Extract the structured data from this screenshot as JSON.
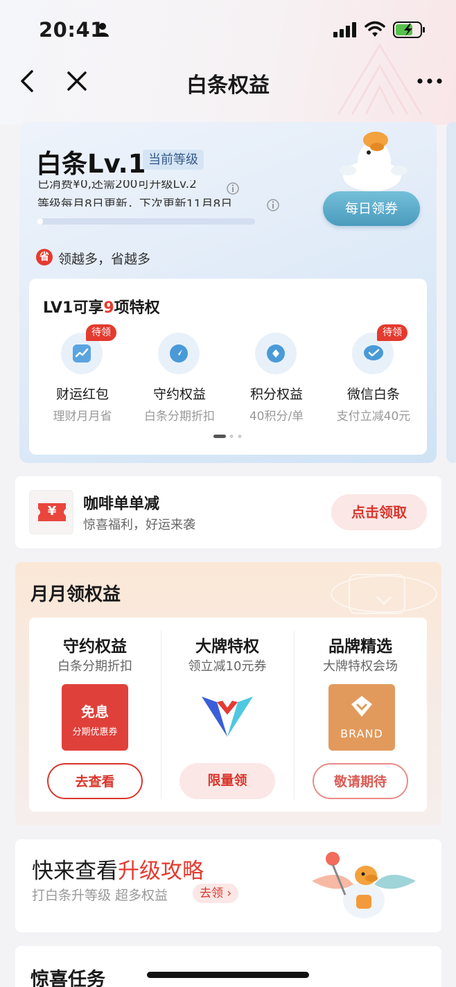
{
  "status_bar": {
    "time": "20:41"
  },
  "nav": {
    "title": "白条权益"
  },
  "level_card": {
    "title": "白条Lv.1",
    "badge": "当前等级",
    "line1": "已消费¥0,还需200可升级Lv.2",
    "line2": "等级每月8日更新，下次更新11月8日",
    "progress": 0.02,
    "daily_button": "每日领券",
    "slogan_icon": "省",
    "slogan": "领越多，省越多",
    "privileges": {
      "title_prefix": "LV1可享",
      "title_count": "9",
      "title_suffix": "项特权",
      "items": [
        {
          "name": "财运红包",
          "sub": "理财月月省",
          "tag": "待领",
          "icon": "chart-icon"
        },
        {
          "name": "守约权益",
          "sub": "白条分期折扣",
          "tag": "",
          "icon": "compass-icon"
        },
        {
          "name": "积分权益",
          "sub": "40积分/单",
          "tag": "",
          "icon": "diamond-icon"
        },
        {
          "name": "微信白条",
          "sub": "支付立减40元",
          "tag": "待领",
          "icon": "wechat-check-icon"
        }
      ]
    }
  },
  "coffee": {
    "title": "咖啡单单减",
    "sub": "惊喜福利，好运来袭",
    "button": "点击领取",
    "icon_glyph": "¥"
  },
  "monthly": {
    "title": "月月领权益",
    "columns": [
      {
        "title": "守约权益",
        "sub": "白条分期折扣",
        "coupon_main": "免息",
        "coupon_sub": "分期优惠券",
        "button": "去查看"
      },
      {
        "title": "大牌特权",
        "sub": "领立减10元券",
        "button": "限量领"
      },
      {
        "title": "品牌精选",
        "sub": "大牌特权会场",
        "brand_text": "BRAND",
        "button": "敬请期待"
      }
    ]
  },
  "upgrade": {
    "title_prefix": "快来查看",
    "title_highlight": "升级攻略",
    "sub": "打白条升等级 超多权益",
    "link": "去领"
  },
  "tasks": {
    "title": "惊喜任务"
  },
  "colors": {
    "accent_red": "#e43a2f",
    "daily_button": "#5aaccb",
    "brand_tile": "#e29a5c"
  }
}
